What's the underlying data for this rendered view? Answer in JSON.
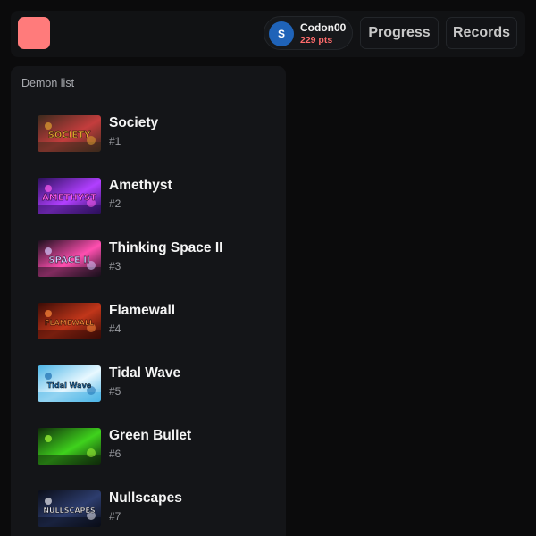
{
  "colors": {
    "background": "#0b0b0c",
    "panel": "#141518",
    "logo": "#ff7b7b",
    "avatar": "#1f63b8",
    "points": "#ff6b6b"
  },
  "header": {
    "logo_icon": "app-logo-icon",
    "user": {
      "avatar_letter": "S",
      "name": "Codon00",
      "points": "229 pts"
    },
    "nav": {
      "progress": "Progress",
      "records": "Records"
    }
  },
  "demon_list": {
    "title": "Demon list",
    "items": [
      {
        "name": "Society",
        "rank": "#1",
        "thumb_text": "SOCIETY",
        "palette": [
          "#3b2a1c",
          "#c43d3d",
          "#e0a030"
        ]
      },
      {
        "name": "Amethyst",
        "rank": "#2",
        "thumb_text": "AMETHYST",
        "palette": [
          "#2a0f5a",
          "#b13fff",
          "#ff5cf0"
        ]
      },
      {
        "name": "Thinking Space II",
        "rank": "#3",
        "thumb_text": "SPACE II",
        "palette": [
          "#1a0f1c",
          "#ff4fb0",
          "#d8c8ff"
        ]
      },
      {
        "name": "Flamewall",
        "rank": "#4",
        "thumb_text": "FLAMEWALL",
        "palette": [
          "#3a0b05",
          "#c1361a",
          "#ff8a3a"
        ]
      },
      {
        "name": "Tidal Wave",
        "rank": "#5",
        "thumb_text": "Tidal Wave",
        "palette": [
          "#4bb4e6",
          "#e8f8ff",
          "#1e6fb0"
        ]
      },
      {
        "name": "Green Bullet",
        "rank": "#6",
        "thumb_text": "",
        "palette": [
          "#0f2a0a",
          "#3fd21d",
          "#a7ff3a"
        ]
      },
      {
        "name": "Nullscapes",
        "rank": "#7",
        "thumb_text": "NULLSCAPES",
        "palette": [
          "#0a0d18",
          "#2d3d6e",
          "#e8e8f0"
        ]
      }
    ]
  }
}
